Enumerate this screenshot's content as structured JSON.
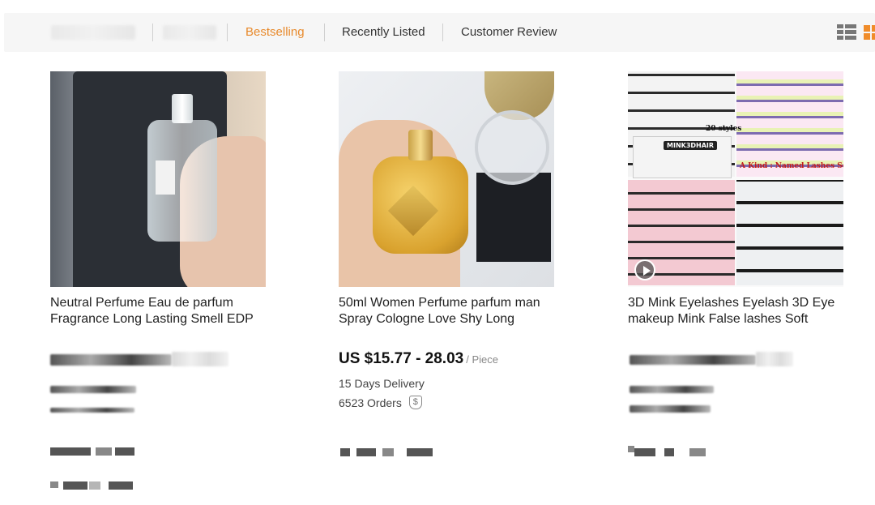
{
  "sortbar": {
    "tabs": [
      {
        "label": "Bestselling",
        "active": true
      },
      {
        "label": "Recently Listed",
        "active": false
      },
      {
        "label": "Customer Review",
        "active": false
      }
    ]
  },
  "view_toggle": {
    "list_icon": "list-view-icon",
    "grid_icon": "grid-view-icon",
    "active_color": "#f08c2a"
  },
  "products": [
    {
      "title_line1": "Neutral Perfume Eau de parfum",
      "title_line2": "Fragrance Long Lasting Smell EDP"
    },
    {
      "title_line1": "50ml Women Perfume parfum man",
      "title_line2": "Spray Cologne Love Shy Long",
      "price": "US $15.77 - 28.03",
      "unit": "/ Piece",
      "delivery": "15 Days Delivery",
      "orders": "6523 Orders",
      "badge_icon": "dollar-badge-icon"
    },
    {
      "title_line1": "3D Mink Eyelashes Eyelash 3D Eye",
      "title_line2": "makeup Mink False lashes Soft",
      "image_text": {
        "styles": "20 styles",
        "kind": "A Kind : Named Lashes Set",
        "package": "MINK3DHAIR"
      }
    }
  ],
  "colors": {
    "accent": "#e88a2c",
    "sortbar_bg": "#f6f6f6",
    "text": "#222222"
  }
}
